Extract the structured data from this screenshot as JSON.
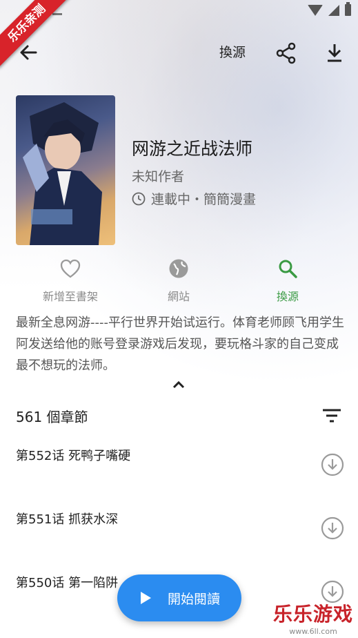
{
  "ribbon": "乐乐亲测",
  "toolbar": {
    "source_label": "換源"
  },
  "book": {
    "title": "网游之近战法师",
    "author": "未知作者",
    "status": "連載中・簡簡漫畫"
  },
  "actions": [
    {
      "label": "新增至書架",
      "icon": "heart-outline-icon"
    },
    {
      "label": "網站",
      "icon": "globe-icon"
    },
    {
      "label": "換源",
      "icon": "search-icon"
    }
  ],
  "description": "最新全息网游----平行世界开始试运行。体育老师顾飞用学生阿发送给他的账号登录游戏后发现，要玩格斗家的自己变成最不想玩的法师。",
  "chapters": {
    "count_label": "561 個章節",
    "items": [
      {
        "title": "第552话 死鸭子嘴硬"
      },
      {
        "title": "第551话 抓获水深"
      },
      {
        "title": "第550话 第一陷阱"
      }
    ]
  },
  "fab": {
    "label": "開始閱讀"
  },
  "watermark": {
    "main": "乐乐游戏",
    "url": "www.6ll.com"
  },
  "colors": {
    "accent": "#2b8cf0",
    "active_green": "#3a9a43",
    "ribbon_red": "#d8232a"
  }
}
